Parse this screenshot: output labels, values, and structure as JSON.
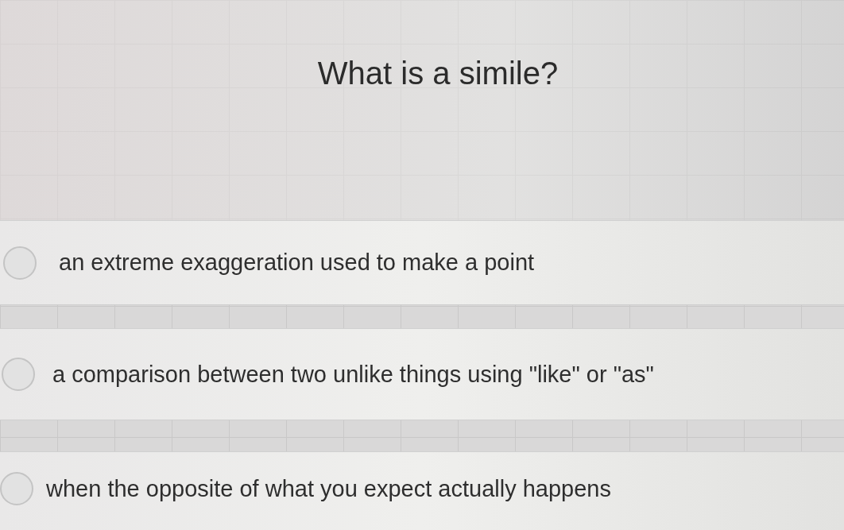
{
  "question": {
    "text": "What is a simile?"
  },
  "options": [
    {
      "text": "an extreme exaggeration used to make a point",
      "selected": false
    },
    {
      "text": "a comparison between two unlike things using \"like\" or \"as\"",
      "selected": false
    },
    {
      "text": "when the opposite of what you expect actually happens",
      "selected": false
    }
  ]
}
